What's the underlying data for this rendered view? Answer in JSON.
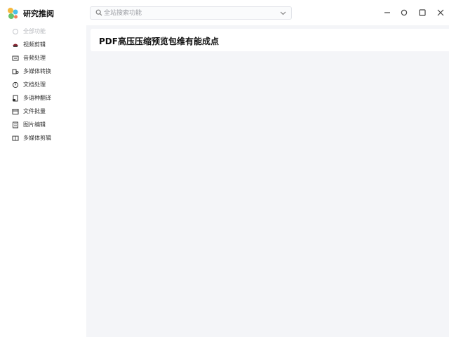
{
  "app": {
    "title": "研究推阅"
  },
  "search": {
    "placeholder": "全站搜索功能"
  },
  "sidebar": {
    "items": [
      {
        "label": "全部功能",
        "icon": "all-icon",
        "muted": true
      },
      {
        "label": "视频剪辑",
        "icon": "video-icon"
      },
      {
        "label": "音频处理",
        "icon": "audio-icon"
      },
      {
        "label": "多媒体转换",
        "icon": "media-convert-icon"
      },
      {
        "label": "文档处理",
        "icon": "document-icon"
      },
      {
        "label": "多语种翻译",
        "icon": "translate-icon"
      },
      {
        "label": "文件批量",
        "icon": "batch-file-icon"
      },
      {
        "label": "图片编辑",
        "icon": "image-icon"
      },
      {
        "label": "多媒体剪辑",
        "icon": "multimedia-edit-icon"
      }
    ]
  },
  "main": {
    "title": "PDF高压压缩预览包维有能成点"
  },
  "colors": {
    "window_bg": "#f4f5f8",
    "panel_bg": "#ffffff",
    "text": "#111111",
    "muted_text": "#b7b9be"
  }
}
